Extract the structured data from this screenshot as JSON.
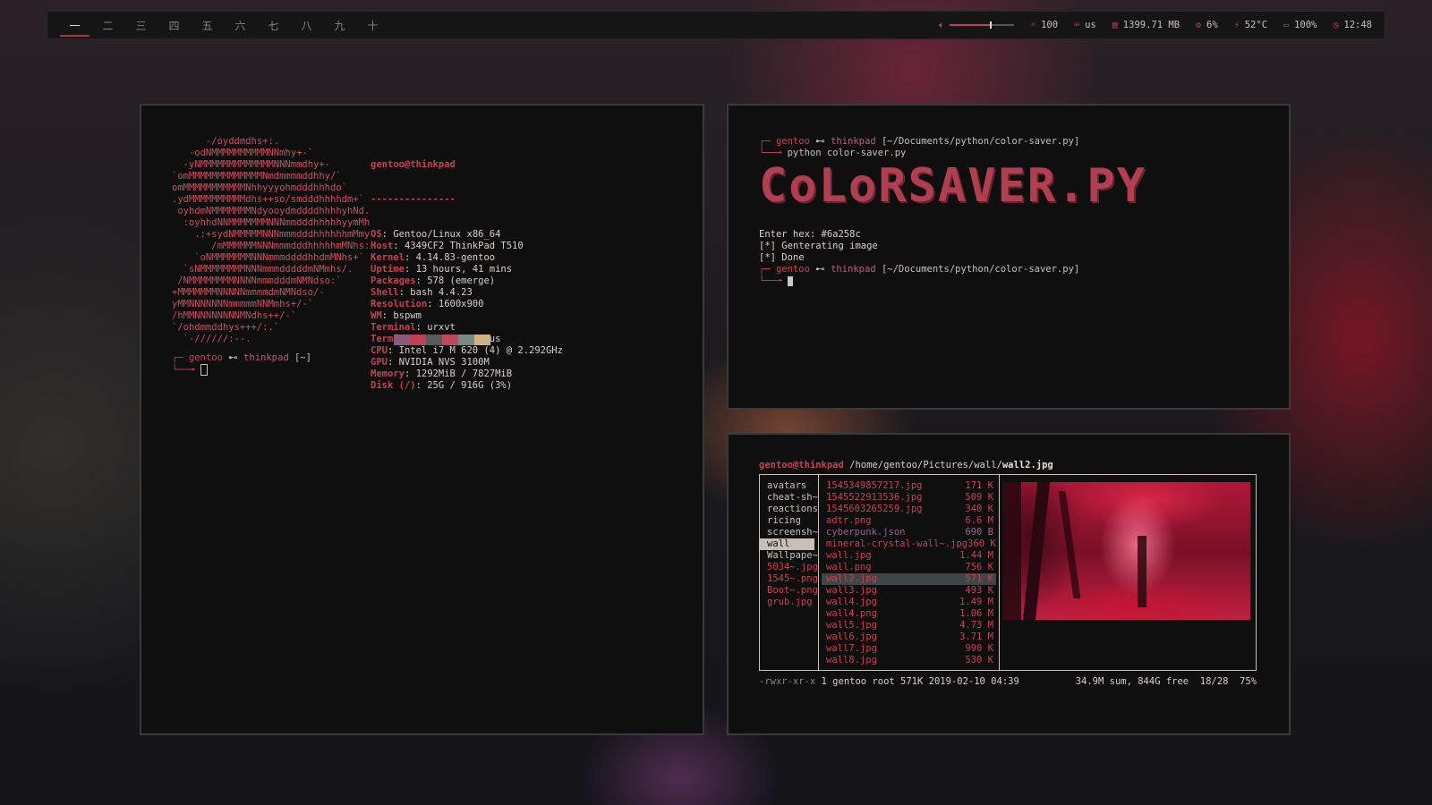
{
  "bar": {
    "workspaces": [
      {
        "label": "一",
        "active": true
      },
      {
        "label": "二"
      },
      {
        "label": "三"
      },
      {
        "label": "四"
      },
      {
        "label": "五"
      },
      {
        "label": "六"
      },
      {
        "label": "七"
      },
      {
        "label": "八"
      },
      {
        "label": "九"
      },
      {
        "label": "十"
      }
    ],
    "volume_fraction": 0.62,
    "brightness": "100",
    "keyboard": "us",
    "memory": "1399.71 MB",
    "cpu": "6%",
    "temp": "52°C",
    "battery": "100%",
    "clock": "12:48",
    "accent": "#c84050"
  },
  "neofetch": {
    "ascii": [
      "      -/oyddmdhs+:.",
      "   -odNMMMMMMMMMMNNmhy+-`",
      "  -yNMMMMMMMMMMMMMNNNmmdhy+-",
      "`omMMMMMMMMMMMMMNmdmmmmddhhy/`",
      "omMMMMMMMMMMMNhhyyyohmdddhhhdo`",
      ".ydMMMMMMMMMMdhs++so/smdddhhhhdm+`",
      " oyhdmNMMMMMMMNdyooydmddddhhhhyhNd.",
      "  :oyhhdNNMMMMMMMNNNmmdddhhhhhyymMh",
      "    .:+sydNMMMMMNNNmmmdddhhhhhhmMmy",
      "       /mMMMMMMNNNmmmdddhhhhhmMNhs:",
      "    `oNMMMMMMMNNNmmmddddhhdmMNhs+`",
      "  `sNMMMMMMMMNNNmmmdddddmNMmhs/.",
      " /NMMMMMMMMNNNNmmmdddmNMNdso:`",
      "+MMMMMMMNNNNNmmmmdmNMNdso/-",
      "yMMNNNNNNNmmmmmNNMmhs+/-`",
      "/hMMNNNNNNNNMNdhs++/-`",
      "`/ohdmmddhys+++/:.`",
      "  `-//////:--."
    ],
    "title": "gentoo@thinkpad",
    "underline": "---------------",
    "rows": [
      {
        "key": "OS",
        "value": "Gentoo/Linux x86_64"
      },
      {
        "key": "Host",
        "value": "4349CF2 ThinkPad T510"
      },
      {
        "key": "Kernel",
        "value": "4.14.83-gentoo"
      },
      {
        "key": "Uptime",
        "value": "13 hours, 41 mins"
      },
      {
        "key": "Packages",
        "value": "578 (emerge)"
      },
      {
        "key": "Shell",
        "value": "bash 4.4.23"
      },
      {
        "key": "Resolution",
        "value": "1600x900"
      },
      {
        "key": "WM",
        "value": "bspwm"
      },
      {
        "key": "Terminal",
        "value": "urxvt"
      },
      {
        "key": "Terminal Font",
        "value": "terminus"
      },
      {
        "key": "CPU",
        "value": "Intel i7 M 620 (4) @ 2.292GHz"
      },
      {
        "key": "GPU",
        "value": "NVIDIA NVS 3100M"
      },
      {
        "key": "Memory",
        "value": "1292MiB / 7827MiB"
      },
      {
        "key": "Disk (/)",
        "value": "25G / 916G (3%)"
      }
    ],
    "swatches": [
      "#8a5a7a",
      "#c04058",
      "#5a5a5a",
      "#c04858",
      "#7a8a80",
      "#d0b080"
    ],
    "prompt": {
      "user": "gentoo",
      "arrow": "⊷",
      "host": "thinkpad",
      "path": "[~]"
    }
  },
  "colorsaver": {
    "prompt1": {
      "user": "gentoo",
      "arrow": "⊷",
      "host": "thinkpad",
      "path": "[~/Documents/python/color-saver.py]"
    },
    "command": "python color-saver.py",
    "banner": "CoLoRSAVER.PY",
    "output": [
      "Enter hex: #6a258c",
      "[*] Genterating image",
      "[*] Done"
    ],
    "prompt2": {
      "user": "gentoo",
      "arrow": "⊷",
      "host": "thinkpad",
      "path": "[~/Documents/python/color-saver.py]"
    }
  },
  "ranger": {
    "userhost": "gentoo@thinkpad",
    "dir": " /home/gentoo/Pictures/wall/",
    "file": "wall2.jpg",
    "parent": [
      {
        "name": "avatars",
        "kind": "dir"
      },
      {
        "name": "cheat-sh~",
        "kind": "dir"
      },
      {
        "name": "reactions",
        "kind": "dir"
      },
      {
        "name": "ricing",
        "kind": "dir"
      },
      {
        "name": "screensh~",
        "kind": "dir"
      },
      {
        "name": "wall",
        "kind": "sel"
      },
      {
        "name": "Wallpape~",
        "kind": "dir"
      },
      {
        "name": "5034~.jpg",
        "kind": "file"
      },
      {
        "name": "1545~.png",
        "kind": "file"
      },
      {
        "name": "Boot~.png",
        "kind": "file"
      },
      {
        "name": "grub.jpg",
        "kind": "file"
      }
    ],
    "files": [
      {
        "name": "1545349857217.jpg",
        "size": "171 K"
      },
      {
        "name": "1545522913536.jpg",
        "size": "509 K"
      },
      {
        "name": "1545603265259.jpg",
        "size": "340 K"
      },
      {
        "name": "adtr.png",
        "size": "6.6 M"
      },
      {
        "name": "cyberpunk.json",
        "size": "690 B",
        "kind": "json"
      },
      {
        "name": "mineral-crystal-wall~.jpg",
        "size": "360 K"
      },
      {
        "name": "wall.jpg",
        "size": "1.44 M"
      },
      {
        "name": "wall.png",
        "size": "756 K"
      },
      {
        "name": "wall2.jpg",
        "size": "571 K",
        "kind": "sel"
      },
      {
        "name": "wall3.jpg",
        "size": "493 K"
      },
      {
        "name": "wall4.jpg",
        "size": "1.49 M"
      },
      {
        "name": "wall4.png",
        "size": "1.06 M"
      },
      {
        "name": "wall5.jpg",
        "size": "4.73 M"
      },
      {
        "name": "wall6.jpg",
        "size": "3.71 M"
      },
      {
        "name": "wall7.jpg",
        "size": "990 K"
      },
      {
        "name": "wall8.jpg",
        "size": "530 K"
      }
    ],
    "status_perm": "-rwxr-xr-x",
    "status_info": " 1 gentoo root 571K 2019-02-10 04:39",
    "status_right": "34.9M sum, 844G free  18/28  75%"
  }
}
